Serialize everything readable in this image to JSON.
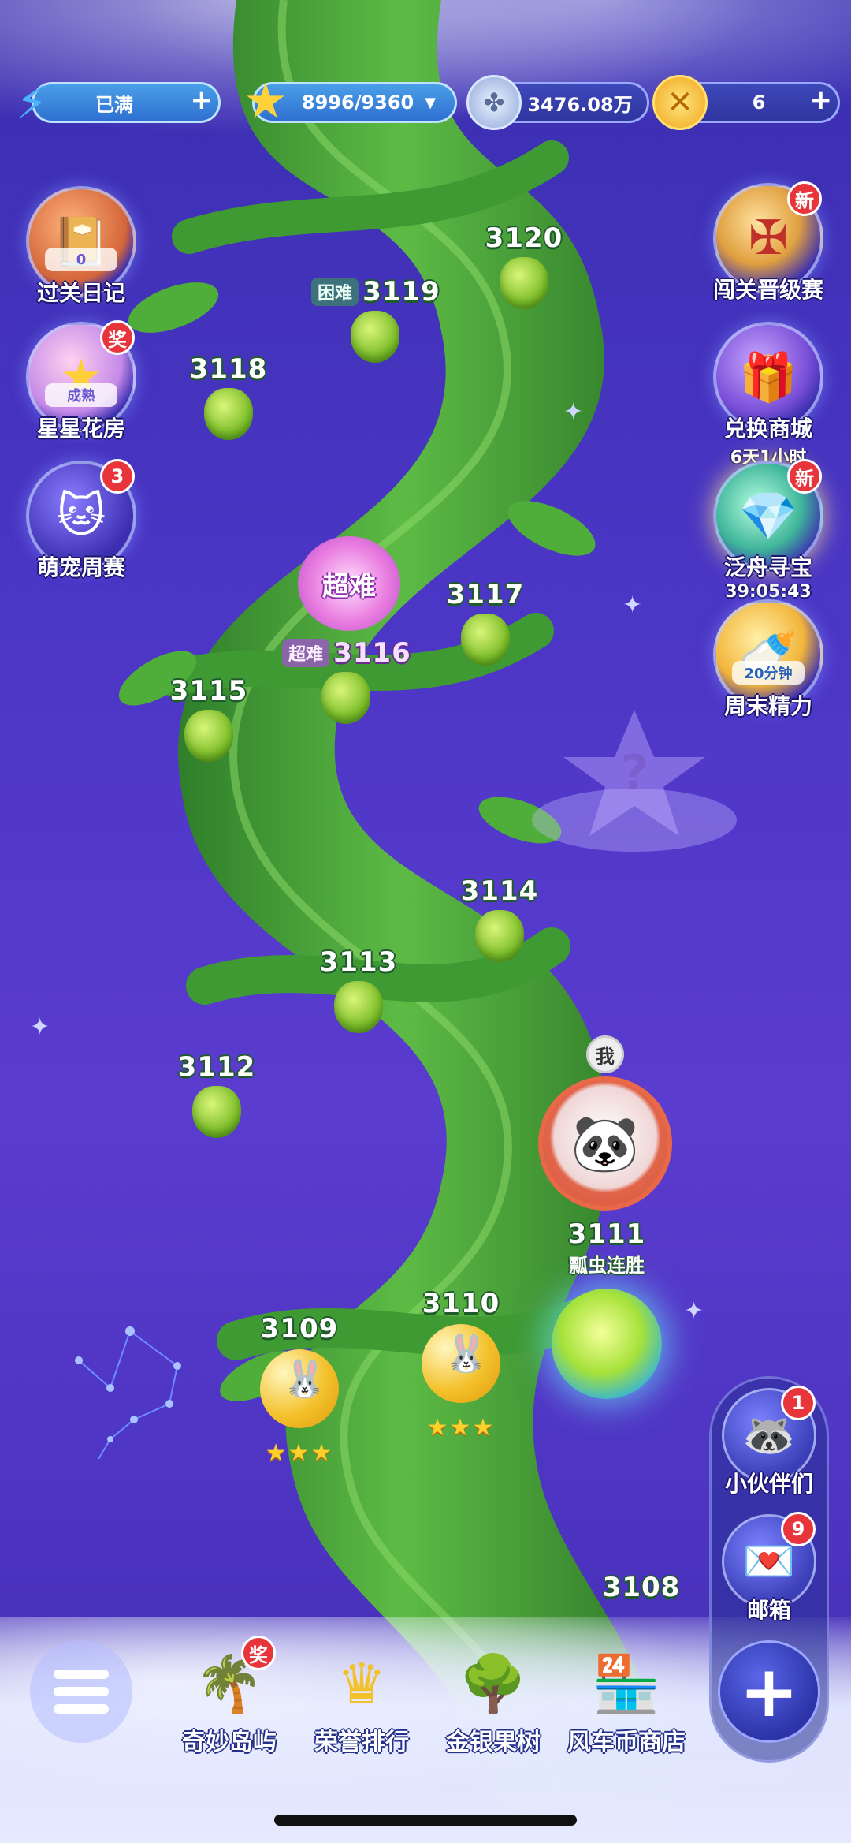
{
  "resources": {
    "energy": {
      "value": "已满",
      "plus": "+"
    },
    "stars": {
      "value": "8996/9360",
      "dropdown": "▼"
    },
    "coins": {
      "value": "3476.08万"
    },
    "gold": {
      "value": "6",
      "plus": "+"
    }
  },
  "left_menu": [
    {
      "label": "过关日记",
      "icon": "diary-icon",
      "chip": "0"
    },
    {
      "label": "星星花房",
      "icon": "star-flower-icon",
      "badge": "奖",
      "chip": "成熟"
    },
    {
      "label": "萌宠周赛",
      "icon": "cat-icon",
      "badge": "3"
    }
  ],
  "right_menu": [
    {
      "label": "闯关晋级赛",
      "icon": "rank-badge-icon",
      "badge": "新"
    },
    {
      "label": "兑换商城",
      "sub": "6天1小时",
      "icon": "gift-box-icon"
    },
    {
      "label": "泛舟寻宝",
      "sub": "39:05:43",
      "icon": "treasure-icon",
      "badge": "新"
    },
    {
      "label": "周末精力",
      "chip": "20分钟",
      "icon": "bottle-icon"
    }
  ],
  "levels": {
    "l3120": "3120",
    "l3119": "3119",
    "l3119_tag": "困难",
    "l3118": "3118",
    "l3117": "3117",
    "l3116": "3116",
    "l3116_tag": "超难",
    "super_flower": "超难",
    "l3115": "3115",
    "l3114": "3114",
    "l3113": "3113",
    "l3112": "3112",
    "l3111": "3111",
    "l3110": "3110",
    "l3110_stars": "★★★",
    "l3109": "3109",
    "l3109_stars": "★★★",
    "l3108": "3108"
  },
  "player": {
    "tag": "我",
    "streak": "瓢虫连胜"
  },
  "side_panel": [
    {
      "label": "小伙伴们",
      "badge": "1",
      "icon": "raccoon-icon"
    },
    {
      "label": "邮箱",
      "badge": "9",
      "icon": "mail-icon"
    },
    {
      "label": "+",
      "icon": "plus-icon"
    }
  ],
  "dock": [
    {
      "label": "奇妙岛屿",
      "badge": "奖",
      "icon": "palm-island-icon"
    },
    {
      "label": "荣誉排行",
      "icon": "crown-icon"
    },
    {
      "label": "金银果树",
      "icon": "fruit-tree-icon"
    },
    {
      "label": "风车币商店",
      "icon": "shop-icon"
    }
  ],
  "colors": {
    "background": "#4a35c4",
    "stalk": "#4fae3a",
    "accent": "#e8343b"
  }
}
